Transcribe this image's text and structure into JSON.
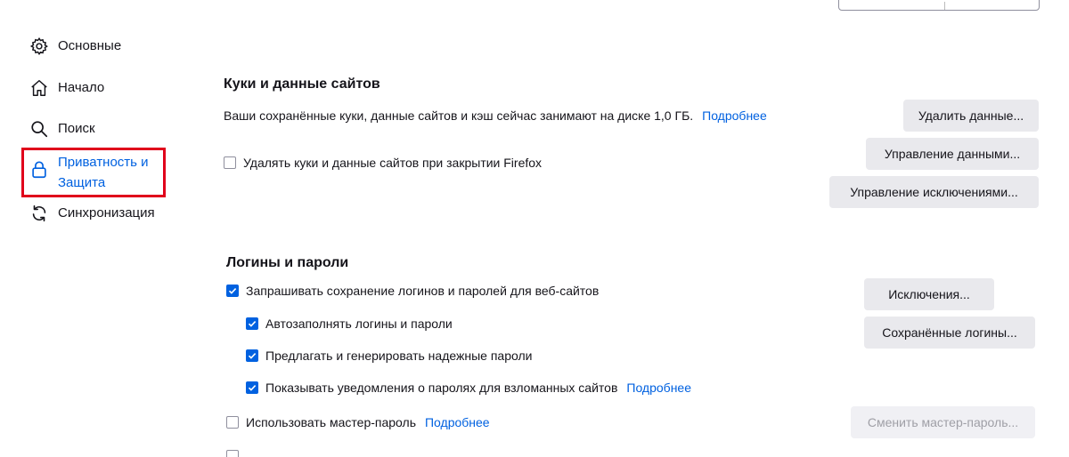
{
  "sidebar": {
    "items": [
      {
        "label": "Основные",
        "icon": "gear-icon"
      },
      {
        "label": "Начало",
        "icon": "home-icon"
      },
      {
        "label": "Поиск",
        "icon": "search-icon"
      },
      {
        "label": "Приватность и Защита",
        "icon": "lock-icon",
        "selected": true
      },
      {
        "label": "Синхронизация",
        "icon": "sync-icon"
      }
    ]
  },
  "cookies": {
    "title": "Куки и данные сайтов",
    "description": "Ваши сохранённые куки, данные сайтов и кэш сейчас занимают на диске 1,0 ГБ.",
    "learn_more": "Подробнее",
    "delete_on_close_label": "Удалять куки и данные сайтов при закрытии Firefox",
    "delete_on_close_checked": false,
    "clear_data_button": "Удалить данные...",
    "manage_data_button": "Управление данными...",
    "manage_exceptions_button": "Управление исключениями..."
  },
  "logins": {
    "title": "Логины и пароли",
    "ask_to_save_label": "Запрашивать сохранение логинов и паролей для веб-сайтов",
    "ask_to_save_checked": true,
    "autofill_label": "Автозаполнять логины и пароли",
    "autofill_checked": true,
    "suggest_label": "Предлагать и генерировать надежные пароли",
    "suggest_checked": true,
    "breach_alerts_label": "Показывать уведомления о паролях для взломанных сайтов",
    "breach_alerts_checked": true,
    "breach_learn_more": "Подробнее",
    "master_password_label": "Использовать мастер-пароль",
    "master_password_checked": false,
    "master_learn_more": "Подробнее",
    "exceptions_button": "Исключения...",
    "saved_logins_button": "Сохранённые логины...",
    "change_master_button": "Сменить мастер-пароль..."
  },
  "colors": {
    "accent": "#0061e0",
    "highlight": "#e0001b",
    "button_bg": "#e9e9ed"
  }
}
